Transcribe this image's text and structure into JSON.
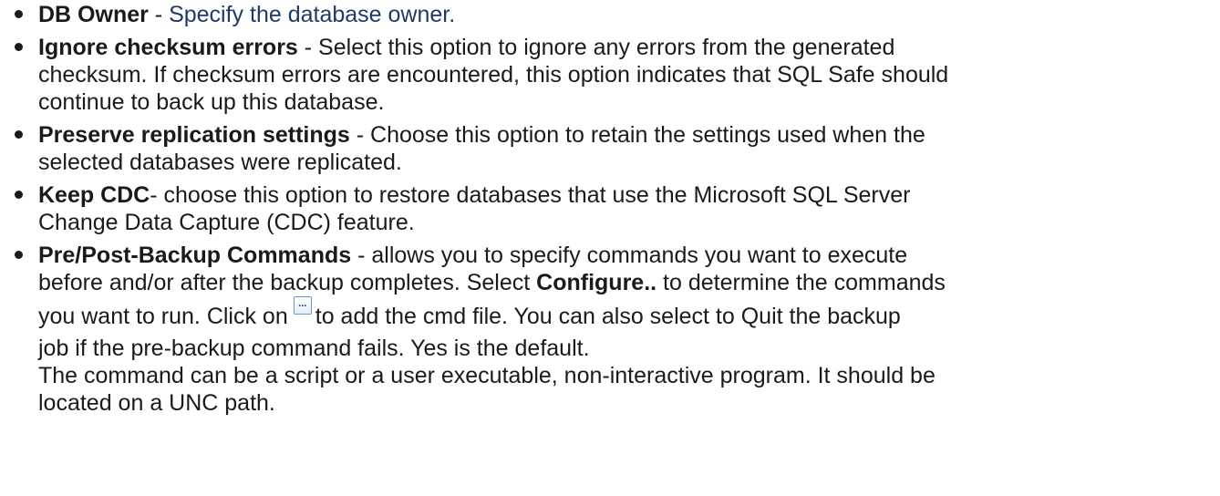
{
  "items": [
    {
      "term": "DB Owner",
      "separator": " - ",
      "desc": "Specify the database owner."
    },
    {
      "term": "Ignore checksum errors",
      "lines": [
        " - Select this option to ignore any errors from the generated",
        "checksum. If checksum errors are encountered, this option indicates that SQL Safe should",
        "continue to back up this database."
      ]
    },
    {
      "term": "Preserve replication settings",
      "lines": [
        " - Choose this option to retain the settings used when the",
        "selected databases were replicated."
      ]
    },
    {
      "term": "Keep CDC",
      "lines": [
        "- choose this option to restore databases that use the Microsoft SQL Server",
        "Change Data Capture (CDC) feature."
      ]
    },
    {
      "term": "Pre/Post-Backup Commands",
      "line1": " - allows you to specify commands you want to execute",
      "line2_pre": "before and/or after the backup completes. Select ",
      "line2_bold": "Configure..",
      "line2_post": " to determine the commands",
      "line3_pre": "you want to run. Click on",
      "button_icon": "ellipsis-button-icon",
      "button_dots": "...",
      "line3_post": "to add the cmd file. You can also select to Quit the backup",
      "line4": "job if the pre-backup command fails. Yes is the default.",
      "line5": "The command can be a script or a user executable, non-interactive program. It should be",
      "line6": "located on a UNC path."
    }
  ]
}
